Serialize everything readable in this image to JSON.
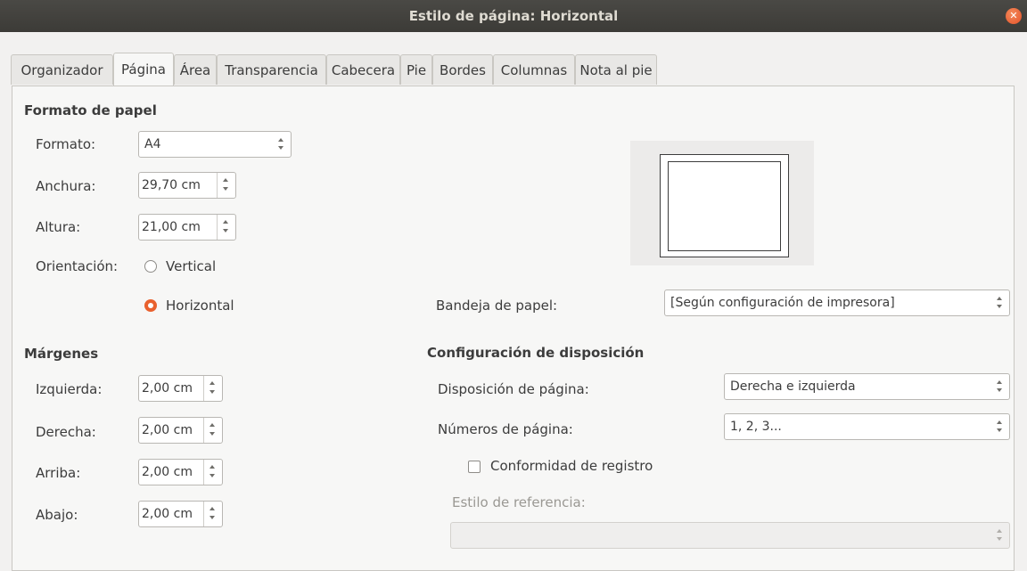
{
  "window": {
    "title": "Estilo de página: Horizontal",
    "close_icon": "close-icon"
  },
  "tabs": [
    {
      "label": "Organizador",
      "active": false
    },
    {
      "label": "Página",
      "active": true
    },
    {
      "label": "Área",
      "active": false
    },
    {
      "label": "Transparencia",
      "active": false
    },
    {
      "label": "Cabecera",
      "active": false
    },
    {
      "label": "Pie",
      "active": false
    },
    {
      "label": "Bordes",
      "active": false
    },
    {
      "label": "Columnas",
      "active": false
    },
    {
      "label": "Nota al pie",
      "active": false
    }
  ],
  "paper": {
    "header": "Formato de papel",
    "format_label": "Formato:",
    "format_value": "A4",
    "width_label": "Anchura:",
    "width_value": "29,70 cm",
    "height_label": "Altura:",
    "height_value": "21,00 cm",
    "orientation_label": "Orientación:",
    "vertical_label": "Vertical",
    "horizontal_label": "Horizontal",
    "orientation_selected": "Horizontal",
    "tray_label": "Bandeja de papel:",
    "tray_value": "[Según configuración de impresora]"
  },
  "margins": {
    "header": "Márgenes",
    "left_label": "Izquierda:",
    "left_value": "2,00 cm",
    "right_label": "Derecha:",
    "right_value": "2,00 cm",
    "top_label": "Arriba:",
    "top_value": "2,00 cm",
    "bottom_label": "Abajo:",
    "bottom_value": "2,00 cm"
  },
  "layout": {
    "header": "Configuración de disposición",
    "page_layout_label": "Disposición de página:",
    "page_layout_value": "Derecha e izquierda",
    "page_numbers_label": "Números de página:",
    "page_numbers_value": "1, 2, 3...",
    "register_label": "Conformidad de registro",
    "register_checked": false,
    "reference_style_label": "Estilo de referencia:",
    "reference_style_value": ""
  },
  "colors": {
    "accent": "#e9612e",
    "titlebar": "#3c3b37"
  }
}
